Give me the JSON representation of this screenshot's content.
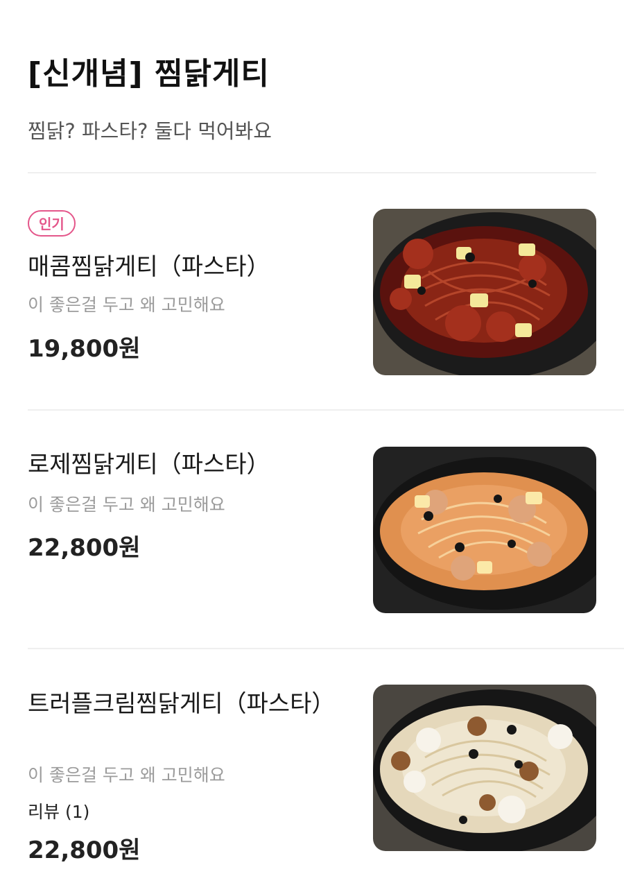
{
  "header": {
    "title": "[신개념] 찜닭게티",
    "subtitle": "찜닭? 파스타? 둘다 먹어봐요"
  },
  "menu": {
    "items": [
      {
        "badge": "인기",
        "name": "매콤찜닭게티（파스타）",
        "description": "이 좋은걸 두고 왜 고민해요",
        "price": "19,800원"
      },
      {
        "name": "로제찜닭게티（파스타）",
        "description": "이 좋은걸 두고 왜 고민해요",
        "price": "22,800원"
      },
      {
        "name": "트러플크림찜닭게티（파스타）",
        "description": "이 좋은걸 두고 왜 고민해요",
        "review": "리뷰 (1)",
        "price": "22,800원"
      }
    ]
  },
  "colors": {
    "badge": "#e4568a",
    "divider": "#efefef",
    "muted_text": "#9b9b9b"
  }
}
